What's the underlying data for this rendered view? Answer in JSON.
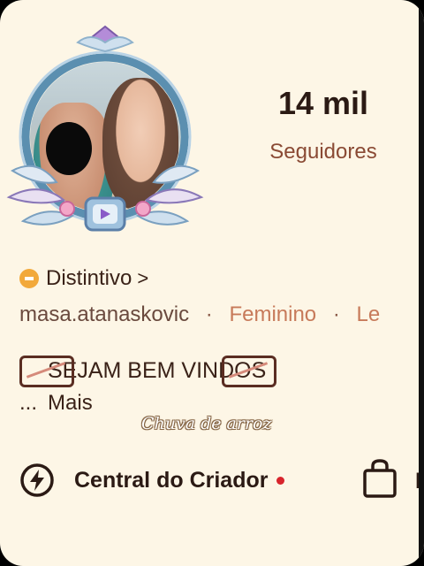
{
  "profile": {
    "followers_count": "14 mil",
    "followers_label": "Seguidores",
    "badge_label": "Distintivo",
    "badge_chevron": ">",
    "username": "masa.atanaskovic",
    "gender": "Feminino",
    "extra_truncated": "Le",
    "separator": "·"
  },
  "bio": {
    "line1": "SEJAM BEM VINDOS",
    "ellipsis": "...",
    "more_label": "Mais"
  },
  "overlay": {
    "caption": "Chuva de arroz"
  },
  "actions": {
    "creator_center": "Central do Criador",
    "shop_truncated": "K"
  },
  "colors": {
    "background": "#fdf6e6",
    "accent": "#c77a5a",
    "notification_dot": "#d8242c",
    "badge": "#f2a93b"
  },
  "icons": {
    "badge": "badge-icon",
    "creator": "lightning-icon",
    "shop": "shopping-bag-icon"
  }
}
